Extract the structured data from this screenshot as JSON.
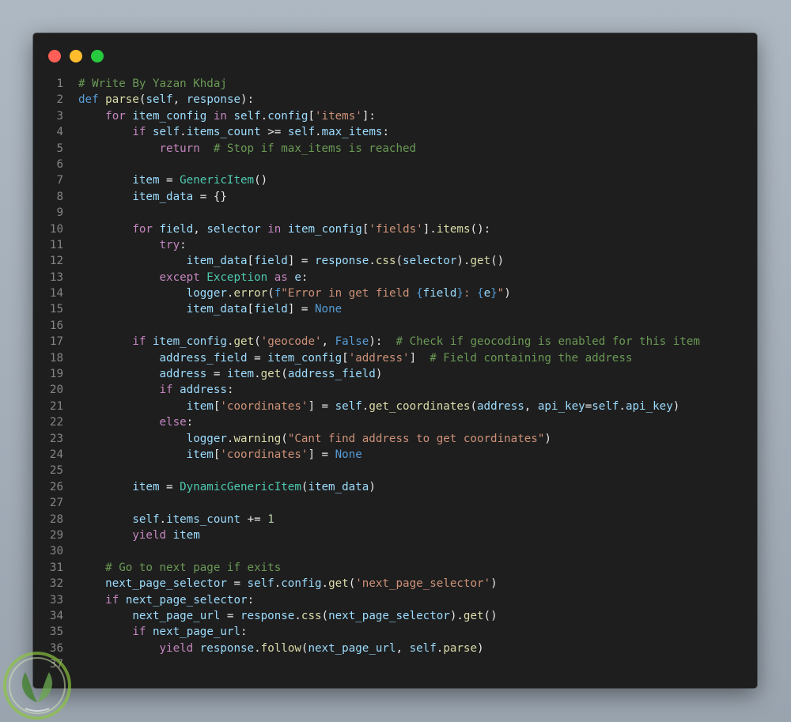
{
  "window": {
    "buttons": [
      "close",
      "minimize",
      "maximize"
    ]
  },
  "colors": {
    "comment": "#6a9955",
    "keyword": "#c586c0",
    "def": "#569cd6",
    "builtin": "#569cd6",
    "string": "#ce9178",
    "class": "#4ec9b0",
    "func": "#dcdcaa",
    "var": "#9cdcfe",
    "num": "#b5cea8",
    "plain": "#e6e6e6",
    "background": "#1e1e1e",
    "line_number": "#858585"
  },
  "code": {
    "lines": [
      [
        [
          "comment",
          "# Write By Yazan Khdaj"
        ]
      ],
      [
        [
          "def",
          "def"
        ],
        [
          "plain",
          " "
        ],
        [
          "func",
          "parse"
        ],
        [
          "plain",
          "("
        ],
        [
          "var",
          "self"
        ],
        [
          "plain",
          ", "
        ],
        [
          "var",
          "response"
        ],
        [
          "plain",
          "):"
        ]
      ],
      [
        [
          "plain",
          "    "
        ],
        [
          "keyword",
          "for"
        ],
        [
          "plain",
          " "
        ],
        [
          "var",
          "item_config"
        ],
        [
          "plain",
          " "
        ],
        [
          "keyword",
          "in"
        ],
        [
          "plain",
          " "
        ],
        [
          "var",
          "self"
        ],
        [
          "plain",
          "."
        ],
        [
          "var",
          "config"
        ],
        [
          "plain",
          "["
        ],
        [
          "string",
          "'items'"
        ],
        [
          "plain",
          "]:"
        ]
      ],
      [
        [
          "plain",
          "        "
        ],
        [
          "keyword",
          "if"
        ],
        [
          "plain",
          " "
        ],
        [
          "var",
          "self"
        ],
        [
          "plain",
          "."
        ],
        [
          "var",
          "items_count"
        ],
        [
          "plain",
          " >= "
        ],
        [
          "var",
          "self"
        ],
        [
          "plain",
          "."
        ],
        [
          "var",
          "max_items"
        ],
        [
          "plain",
          ":"
        ]
      ],
      [
        [
          "plain",
          "            "
        ],
        [
          "keyword",
          "return"
        ],
        [
          "plain",
          "  "
        ],
        [
          "comment",
          "# Stop if max_items is reached"
        ]
      ],
      [],
      [
        [
          "plain",
          "        "
        ],
        [
          "var",
          "item"
        ],
        [
          "plain",
          " = "
        ],
        [
          "class",
          "GenericItem"
        ],
        [
          "plain",
          "()"
        ]
      ],
      [
        [
          "plain",
          "        "
        ],
        [
          "var",
          "item_data"
        ],
        [
          "plain",
          " = {}"
        ]
      ],
      [],
      [
        [
          "plain",
          "        "
        ],
        [
          "keyword",
          "for"
        ],
        [
          "plain",
          " "
        ],
        [
          "var",
          "field"
        ],
        [
          "plain",
          ", "
        ],
        [
          "var",
          "selector"
        ],
        [
          "plain",
          " "
        ],
        [
          "keyword",
          "in"
        ],
        [
          "plain",
          " "
        ],
        [
          "var",
          "item_config"
        ],
        [
          "plain",
          "["
        ],
        [
          "string",
          "'fields'"
        ],
        [
          "plain",
          "]."
        ],
        [
          "func",
          "items"
        ],
        [
          "plain",
          "():"
        ]
      ],
      [
        [
          "plain",
          "            "
        ],
        [
          "keyword",
          "try"
        ],
        [
          "plain",
          ":"
        ]
      ],
      [
        [
          "plain",
          "                "
        ],
        [
          "var",
          "item_data"
        ],
        [
          "plain",
          "["
        ],
        [
          "var",
          "field"
        ],
        [
          "plain",
          "] = "
        ],
        [
          "var",
          "response"
        ],
        [
          "plain",
          "."
        ],
        [
          "func",
          "css"
        ],
        [
          "plain",
          "("
        ],
        [
          "var",
          "selector"
        ],
        [
          "plain",
          ")."
        ],
        [
          "func",
          "get"
        ],
        [
          "plain",
          "()"
        ]
      ],
      [
        [
          "plain",
          "            "
        ],
        [
          "keyword",
          "except"
        ],
        [
          "plain",
          " "
        ],
        [
          "class",
          "Exception"
        ],
        [
          "plain",
          " "
        ],
        [
          "keyword",
          "as"
        ],
        [
          "plain",
          " "
        ],
        [
          "var",
          "e"
        ],
        [
          "plain",
          ":"
        ]
      ],
      [
        [
          "plain",
          "                "
        ],
        [
          "var",
          "logger"
        ],
        [
          "plain",
          "."
        ],
        [
          "func",
          "error"
        ],
        [
          "plain",
          "("
        ],
        [
          "def",
          "f"
        ],
        [
          "string",
          "\"Error in get field "
        ],
        [
          "def",
          "{"
        ],
        [
          "var",
          "field"
        ],
        [
          "def",
          "}"
        ],
        [
          "string",
          ": "
        ],
        [
          "def",
          "{"
        ],
        [
          "var",
          "e"
        ],
        [
          "def",
          "}"
        ],
        [
          "string",
          "\""
        ],
        [
          "plain",
          ")"
        ]
      ],
      [
        [
          "plain",
          "                "
        ],
        [
          "var",
          "item_data"
        ],
        [
          "plain",
          "["
        ],
        [
          "var",
          "field"
        ],
        [
          "plain",
          "] = "
        ],
        [
          "builtin",
          "None"
        ]
      ],
      [],
      [
        [
          "plain",
          "        "
        ],
        [
          "keyword",
          "if"
        ],
        [
          "plain",
          " "
        ],
        [
          "var",
          "item_config"
        ],
        [
          "plain",
          "."
        ],
        [
          "func",
          "get"
        ],
        [
          "plain",
          "("
        ],
        [
          "string",
          "'geocode'"
        ],
        [
          "plain",
          ", "
        ],
        [
          "builtin",
          "False"
        ],
        [
          "plain",
          "):  "
        ],
        [
          "comment",
          "# Check if geocoding is enabled for this item"
        ]
      ],
      [
        [
          "plain",
          "            "
        ],
        [
          "var",
          "address_field"
        ],
        [
          "plain",
          " = "
        ],
        [
          "var",
          "item_config"
        ],
        [
          "plain",
          "["
        ],
        [
          "string",
          "'address'"
        ],
        [
          "plain",
          "]  "
        ],
        [
          "comment",
          "# Field containing the address"
        ]
      ],
      [
        [
          "plain",
          "            "
        ],
        [
          "var",
          "address"
        ],
        [
          "plain",
          " = "
        ],
        [
          "var",
          "item"
        ],
        [
          "plain",
          "."
        ],
        [
          "func",
          "get"
        ],
        [
          "plain",
          "("
        ],
        [
          "var",
          "address_field"
        ],
        [
          "plain",
          ")"
        ]
      ],
      [
        [
          "plain",
          "            "
        ],
        [
          "keyword",
          "if"
        ],
        [
          "plain",
          " "
        ],
        [
          "var",
          "address"
        ],
        [
          "plain",
          ":"
        ]
      ],
      [
        [
          "plain",
          "                "
        ],
        [
          "var",
          "item"
        ],
        [
          "plain",
          "["
        ],
        [
          "string",
          "'coordinates'"
        ],
        [
          "plain",
          "] = "
        ],
        [
          "var",
          "self"
        ],
        [
          "plain",
          "."
        ],
        [
          "func",
          "get_coordinates"
        ],
        [
          "plain",
          "("
        ],
        [
          "var",
          "address"
        ],
        [
          "plain",
          ", "
        ],
        [
          "var",
          "api_key"
        ],
        [
          "plain",
          "="
        ],
        [
          "var",
          "self"
        ],
        [
          "plain",
          "."
        ],
        [
          "var",
          "api_key"
        ],
        [
          "plain",
          ")"
        ]
      ],
      [
        [
          "plain",
          "            "
        ],
        [
          "keyword",
          "else"
        ],
        [
          "plain",
          ":"
        ]
      ],
      [
        [
          "plain",
          "                "
        ],
        [
          "var",
          "logger"
        ],
        [
          "plain",
          "."
        ],
        [
          "func",
          "warning"
        ],
        [
          "plain",
          "("
        ],
        [
          "string",
          "\"Cant find address to get coordinates\""
        ],
        [
          "plain",
          ")"
        ]
      ],
      [
        [
          "plain",
          "                "
        ],
        [
          "var",
          "item"
        ],
        [
          "plain",
          "["
        ],
        [
          "string",
          "'coordinates'"
        ],
        [
          "plain",
          "] = "
        ],
        [
          "builtin",
          "None"
        ]
      ],
      [],
      [
        [
          "plain",
          "        "
        ],
        [
          "var",
          "item"
        ],
        [
          "plain",
          " = "
        ],
        [
          "class",
          "DynamicGenericItem"
        ],
        [
          "plain",
          "("
        ],
        [
          "var",
          "item_data"
        ],
        [
          "plain",
          ")"
        ]
      ],
      [],
      [
        [
          "plain",
          "        "
        ],
        [
          "var",
          "self"
        ],
        [
          "plain",
          "."
        ],
        [
          "var",
          "items_count"
        ],
        [
          "plain",
          " += "
        ],
        [
          "num",
          "1"
        ]
      ],
      [
        [
          "plain",
          "        "
        ],
        [
          "keyword",
          "yield"
        ],
        [
          "plain",
          " "
        ],
        [
          "var",
          "item"
        ]
      ],
      [],
      [
        [
          "plain",
          "    "
        ],
        [
          "comment",
          "# Go to next page if exits"
        ]
      ],
      [
        [
          "plain",
          "    "
        ],
        [
          "var",
          "next_page_selector"
        ],
        [
          "plain",
          " = "
        ],
        [
          "var",
          "self"
        ],
        [
          "plain",
          "."
        ],
        [
          "var",
          "config"
        ],
        [
          "plain",
          "."
        ],
        [
          "func",
          "get"
        ],
        [
          "plain",
          "("
        ],
        [
          "string",
          "'next_page_selector'"
        ],
        [
          "plain",
          ")"
        ]
      ],
      [
        [
          "plain",
          "    "
        ],
        [
          "keyword",
          "if"
        ],
        [
          "plain",
          " "
        ],
        [
          "var",
          "next_page_selector"
        ],
        [
          "plain",
          ":"
        ]
      ],
      [
        [
          "plain",
          "        "
        ],
        [
          "var",
          "next_page_url"
        ],
        [
          "plain",
          " = "
        ],
        [
          "var",
          "response"
        ],
        [
          "plain",
          "."
        ],
        [
          "func",
          "css"
        ],
        [
          "plain",
          "("
        ],
        [
          "var",
          "next_page_selector"
        ],
        [
          "plain",
          ")."
        ],
        [
          "func",
          "get"
        ],
        [
          "plain",
          "()"
        ]
      ],
      [
        [
          "plain",
          "        "
        ],
        [
          "keyword",
          "if"
        ],
        [
          "plain",
          " "
        ],
        [
          "var",
          "next_page_url"
        ],
        [
          "plain",
          ":"
        ]
      ],
      [
        [
          "plain",
          "            "
        ],
        [
          "keyword",
          "yield"
        ],
        [
          "plain",
          " "
        ],
        [
          "var",
          "response"
        ],
        [
          "plain",
          "."
        ],
        [
          "func",
          "follow"
        ],
        [
          "plain",
          "("
        ],
        [
          "var",
          "next_page_url"
        ],
        [
          "plain",
          ", "
        ],
        [
          "var",
          "self"
        ],
        [
          "plain",
          "."
        ],
        [
          "func",
          "parse"
        ],
        [
          "plain",
          ")"
        ]
      ],
      []
    ]
  },
  "watermark": {
    "icon": "leaf-logo-icon"
  }
}
